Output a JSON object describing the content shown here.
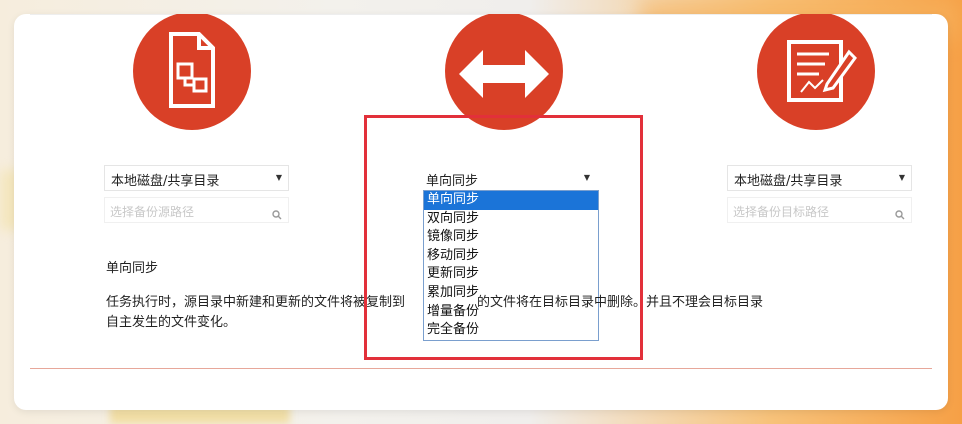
{
  "source": {
    "icon": "document-flowchart-icon",
    "select_value": "本地磁盘/共享目录",
    "path_placeholder": "选择备份源路径"
  },
  "mode": {
    "icon": "double-arrow-icon",
    "select_value": "单向同步",
    "options": [
      "单向同步",
      "双向同步",
      "镜像同步",
      "移动同步",
      "更新同步",
      "累加同步",
      "增量备份",
      "完全备份"
    ],
    "selected_index": 0
  },
  "target": {
    "icon": "edit-document-icon",
    "select_value": "本地磁盘/共享目录",
    "path_placeholder": "选择备份目标路径"
  },
  "description": {
    "title": "单向同步",
    "body_line1": "任务执行时，源目录中新建和更新的文件将被复制到",
    "body_line1_tail": "的文件将在目标目录中删除。并且不理会目标目录",
    "body_line2": "自主发生的文件变化。"
  },
  "colors": {
    "accent": "#d94027",
    "highlight_box": "#e2303a",
    "selected_option": "#1b74d8"
  }
}
